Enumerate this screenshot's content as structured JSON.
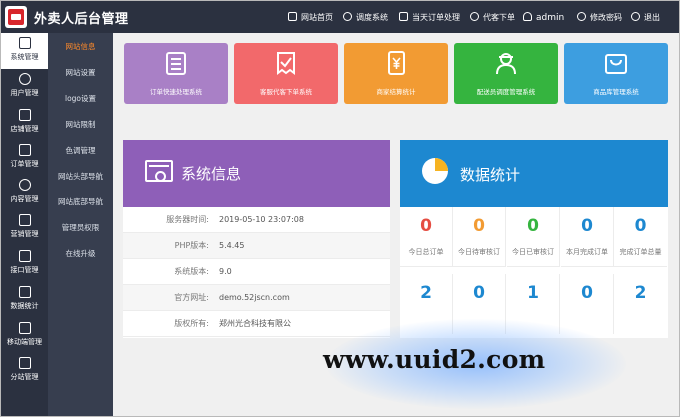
{
  "app": {
    "title": "外卖人后台管理",
    "top_nav": [
      {
        "label": "网站首页",
        "icon": "home-icon"
      },
      {
        "label": "调度系统",
        "icon": "dispatch-icon"
      },
      {
        "label": "当天订单处理",
        "icon": "clipboard-icon"
      },
      {
        "label": "代客下单",
        "icon": "headset-icon"
      },
      {
        "label": "admin",
        "icon": "user-icon"
      },
      {
        "label": "修改密码",
        "icon": "key-icon"
      },
      {
        "label": "退出",
        "icon": "power-icon"
      }
    ]
  },
  "sidebar": {
    "items": [
      {
        "label": "系统管理",
        "icon": "monitor-icon"
      },
      {
        "label": "用户管理",
        "icon": "users-icon"
      },
      {
        "label": "店铺管理",
        "icon": "store-icon"
      },
      {
        "label": "订单管理",
        "icon": "order-icon"
      },
      {
        "label": "内容管理",
        "icon": "grid-icon"
      },
      {
        "label": "营销管理",
        "icon": "chart-bar-icon"
      },
      {
        "label": "接口管理",
        "icon": "api-icon"
      },
      {
        "label": "数据统计",
        "icon": "statistics-icon"
      },
      {
        "label": "移动端管理",
        "icon": "mobile-icon"
      },
      {
        "label": "分站管理",
        "icon": "substation-icon"
      }
    ]
  },
  "submenu": {
    "items": [
      "网站信息",
      "网站设置",
      "logo设置",
      "网站限制",
      "色调管理",
      "网站头部导航",
      "网站底部导航",
      "管理员权限",
      "在线升级"
    ]
  },
  "tiles": [
    {
      "label": "订单快速处理系统",
      "color": "#a980c6",
      "icon": "list-icon"
    },
    {
      "label": "客服代客下单系统",
      "color": "#f2696b",
      "icon": "ticket-check-icon"
    },
    {
      "label": "商家结算统计",
      "color": "#f29b33",
      "icon": "yen-note-icon"
    },
    {
      "label": "配送员调度管理系统",
      "color": "#35b43f",
      "icon": "courier-icon"
    },
    {
      "label": "商品库管理系统",
      "color": "#3d9ee0",
      "icon": "bag-icon"
    }
  ],
  "system_info": {
    "title": "系统信息",
    "rows": [
      {
        "key": "服务器时间:",
        "value": "2019-05-10 23:07:08"
      },
      {
        "key": "PHP版本:",
        "value": "5.4.45"
      },
      {
        "key": "系统版本:",
        "value": "9.0"
      },
      {
        "key": "官方网址:",
        "value": "demo.52jscn.com"
      },
      {
        "key": "版权所有:",
        "value": "郑州光合科技有限公"
      }
    ]
  },
  "stats": {
    "title": "数据统计",
    "row1": [
      {
        "value": "0",
        "label": "今日总订单",
        "color": "#e54d42"
      },
      {
        "value": "0",
        "label": "今日待审核订",
        "color": "#f29b33"
      },
      {
        "value": "0",
        "label": "今日已审核订",
        "color": "#35b43f"
      },
      {
        "value": "0",
        "label": "本月完成订单",
        "color": "#1d88d0"
      },
      {
        "value": "0",
        "label": "完成订单总量",
        "color": "#1d88d0"
      }
    ],
    "row2": [
      {
        "value": "2",
        "color": "#1d88d0"
      },
      {
        "value": "0",
        "color": "#1d88d0"
      },
      {
        "value": "1",
        "color": "#1d88d0"
      },
      {
        "value": "0",
        "color": "#1d88d0"
      },
      {
        "value": "2",
        "color": "#1d88d0"
      }
    ]
  },
  "watermark": "www.uuid2.com"
}
